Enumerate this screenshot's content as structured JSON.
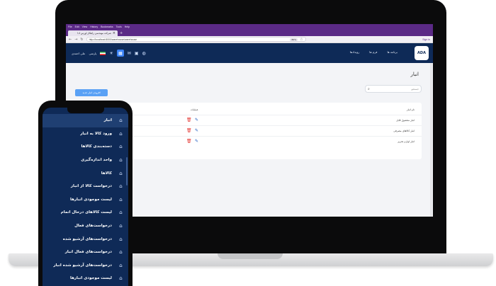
{
  "browser": {
    "menu": [
      "File",
      "Edit",
      "View",
      "History",
      "Bookmarks",
      "Tools",
      "Help"
    ],
    "tab_title": "شرکت مهندسی راهکار آورس آدا",
    "url": "http://localhost:8000/warehouse/warehouse",
    "zoom": "80%",
    "sign_in": "Sign in"
  },
  "header": {
    "menu": [
      "برنامه ها",
      "فرم ها",
      "رویدادها"
    ],
    "user": "علی احمدی",
    "lang": "پارسی",
    "logo_text": "ADA"
  },
  "page": {
    "title": "انبار",
    "add_button": "افزودن انبار جدید",
    "search_placeholder": "جستجو",
    "columns": {
      "name": "نام انبار",
      "ops": "عملیات"
    },
    "rows": [
      {
        "name": "انبار محصول قابل"
      },
      {
        "name": "انبار کالاهای مصرفی"
      },
      {
        "name": "انبار لوازم تحریر"
      }
    ]
  },
  "sidebar": {
    "items": [
      {
        "label": "انبار",
        "icon": "warehouse-icon"
      },
      {
        "label": "ورود کالا به انبار",
        "icon": "warehouse-icon"
      },
      {
        "label": "دسته‌بندی کالاها",
        "icon": "warehouse-icon"
      },
      {
        "label": "واحد اندازه‌گیری",
        "icon": "warehouse-icon"
      },
      {
        "label": "کالاها",
        "icon": "warehouse-icon"
      },
      {
        "label": "درخواست کالا از انبار",
        "icon": "warehouse-icon"
      },
      {
        "label": "لیست موجودی انبارها",
        "icon": "warehouse-icon"
      },
      {
        "label": "لیست کالاهای درحال اتمام",
        "icon": "warehouse-icon"
      },
      {
        "label": "درخواست‌های فعال",
        "icon": "warehouse-icon"
      },
      {
        "label": "درخواست‌های آرشیو شده",
        "icon": "warehouse-icon"
      },
      {
        "label": "درخواست‌های فعال انبار",
        "icon": "warehouse-icon"
      },
      {
        "label": "درخواست‌های آرشیو شده انبار",
        "icon": "warehouse-icon"
      },
      {
        "label": "لیست موجودی انبارها",
        "icon": "warehouse-icon"
      }
    ]
  },
  "colors": {
    "brand": "#0e2a57",
    "accent": "#5aa1f5",
    "danger": "#e53935",
    "browser": "#5b2a86"
  }
}
